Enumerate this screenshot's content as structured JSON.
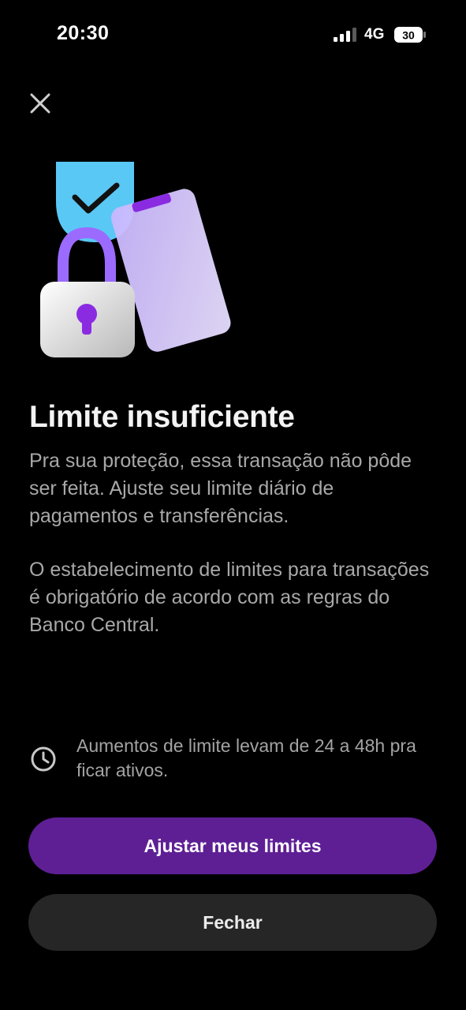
{
  "status_bar": {
    "time": "20:30",
    "network": "4G",
    "battery": "30",
    "signal_icon": "cellular-signal-icon",
    "battery_icon": "battery-icon"
  },
  "close_icon": "close-icon",
  "illustration_icon": "security-lock-phone-illustration",
  "title": "Limite insuficiente",
  "paragraphs": [
    "Pra sua proteção, essa transação não pôde ser feita. Ajuste seu limite diário de pagamentos e transferências.",
    "O estabelecimento de limites para transações é obrigatório de acordo com as regras do Banco Central."
  ],
  "info": {
    "icon": "clock-icon",
    "text": "Aumentos de limite levam de 24 a 48h pra ficar ativos."
  },
  "buttons": {
    "primary": "Ajustar meus limites",
    "secondary": "Fechar"
  },
  "colors": {
    "background": "#000000",
    "primary_button": "#5e1f95",
    "secondary_button": "#262626",
    "accent_purple": "#8a2be2",
    "shield_blue": "#5ac8f5"
  }
}
